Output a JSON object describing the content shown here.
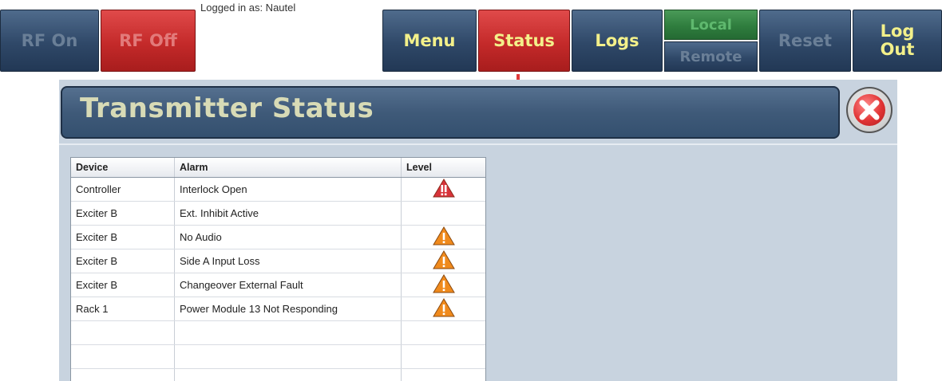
{
  "toolbar": {
    "rf_on": "RF On",
    "rf_off": "RF Off",
    "logged_in": "Logged in as: Nautel",
    "menu": "Menu",
    "status": "Status",
    "logs": "Logs",
    "local": "Local",
    "remote": "Remote",
    "reset": "Reset",
    "logout_line1": "Log",
    "logout_line2": "Out"
  },
  "dialog": {
    "title": "Transmitter Status",
    "close_icon": "close-icon"
  },
  "table": {
    "headers": [
      "Device",
      "Alarm",
      "Level"
    ],
    "rows": [
      {
        "device": "Controller",
        "alarm": "Interlock Open",
        "level": "critical"
      },
      {
        "device": "Exciter B",
        "alarm": "Ext. Inhibit Active",
        "level": ""
      },
      {
        "device": "Exciter B",
        "alarm": "No Audio",
        "level": "warning"
      },
      {
        "device": "Exciter B",
        "alarm": "Side A Input Loss",
        "level": "warning"
      },
      {
        "device": "Exciter B",
        "alarm": "Changeover External Fault",
        "level": "warning"
      },
      {
        "device": "Rack 1",
        "alarm": "Power Module 13 Not Responding",
        "level": "warning"
      },
      {
        "device": "",
        "alarm": "",
        "level": ""
      },
      {
        "device": "",
        "alarm": "",
        "level": ""
      },
      {
        "device": "",
        "alarm": "",
        "level": ""
      }
    ]
  },
  "colors": {
    "critical": "#d8333a",
    "warning": "#f08a1c",
    "title": "#d8dbb6",
    "active_label": "#f3f08a"
  }
}
